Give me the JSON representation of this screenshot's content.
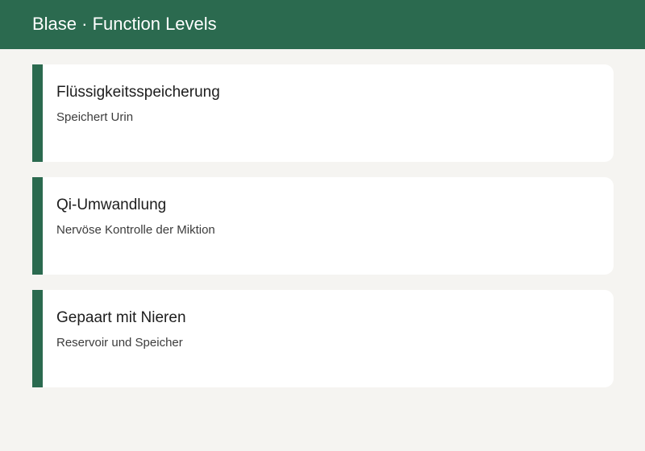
{
  "header": {
    "title": "Blase · Function Levels"
  },
  "cards": [
    {
      "title": "Flüssigkeitsspeicherung",
      "description": "Speichert Urin"
    },
    {
      "title": "Qi-Umwandlung",
      "description": "Nervöse Kontrolle der Miktion"
    },
    {
      "title": "Gepaart mit Nieren",
      "description": "Reservoir und Speicher"
    }
  ],
  "colors": {
    "accent": "#2b6a4f",
    "background": "#f5f4f1",
    "card": "#ffffff"
  }
}
